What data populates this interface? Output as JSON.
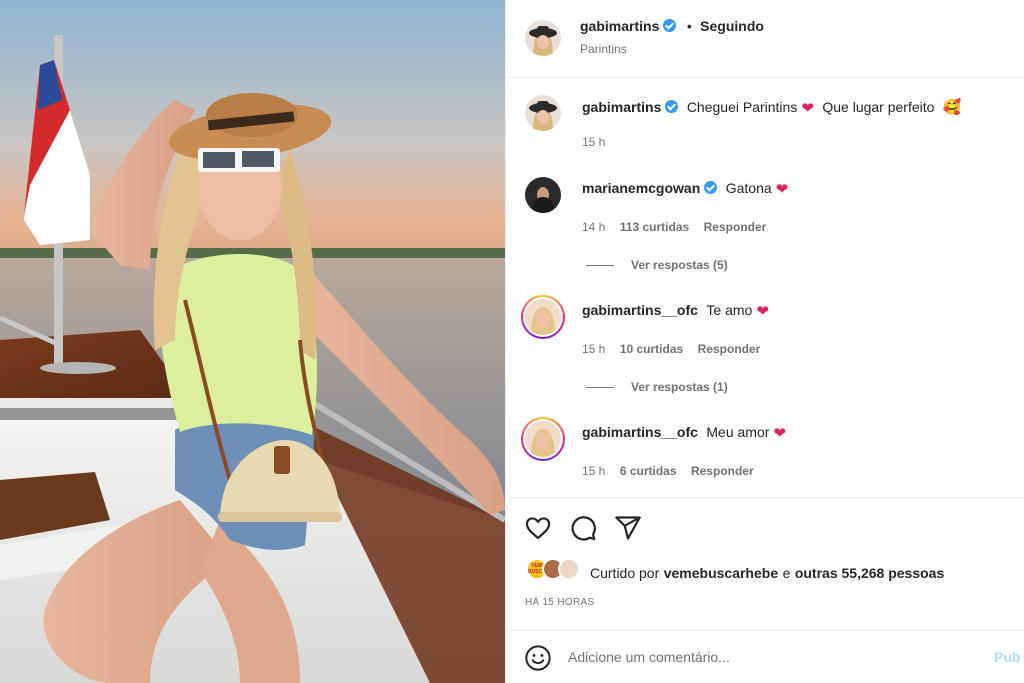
{
  "post": {
    "username": "gabimartins",
    "follow_separator": "•",
    "follow_status": "Seguindo",
    "location": "Parintins"
  },
  "caption": {
    "username": "gabimartins",
    "text_part1": "Cheguei Parintins",
    "text_part2": "Que lugar perfeito",
    "emoji_smile": "🥰",
    "time": "15 h"
  },
  "comments": [
    {
      "username": "marianemcgowan",
      "verified": true,
      "text": "Gatona",
      "time": "14 h",
      "likes": "113 curtidas",
      "reply": "Responder",
      "view_replies": "Ver respostas (5)"
    },
    {
      "username": "gabimartins__ofc",
      "verified": false,
      "text": "Te amo",
      "time": "15 h",
      "likes": "10 curtidas",
      "reply": "Responder",
      "view_replies": "Ver respostas (1)"
    },
    {
      "username": "gabimartins__ofc",
      "verified": false,
      "text": "Meu amor",
      "time": "15 h",
      "likes": "6 curtidas",
      "reply": "Responder"
    }
  ],
  "likes": {
    "prefix": "Curtido por",
    "user": "vemebuscarhebe",
    "conj": "e",
    "others": "outras 55,268 pessoas",
    "avatar_label": "VEM BUSCAR"
  },
  "timestamp": "HÁ 15 HORAS",
  "comment_box": {
    "placeholder": "Adicione um comentário...",
    "post_label": "Pub"
  },
  "icons": {
    "heart": "heart-outline-icon",
    "comment": "comment-bubble-icon",
    "share": "paper-plane-icon",
    "emoji": "smiley-icon",
    "verified": "verified-badge-icon"
  },
  "colors": {
    "verified": "#3897f0",
    "heart": "#e0245e",
    "muted": "#737373",
    "post_disabled": "#b3dbff"
  }
}
